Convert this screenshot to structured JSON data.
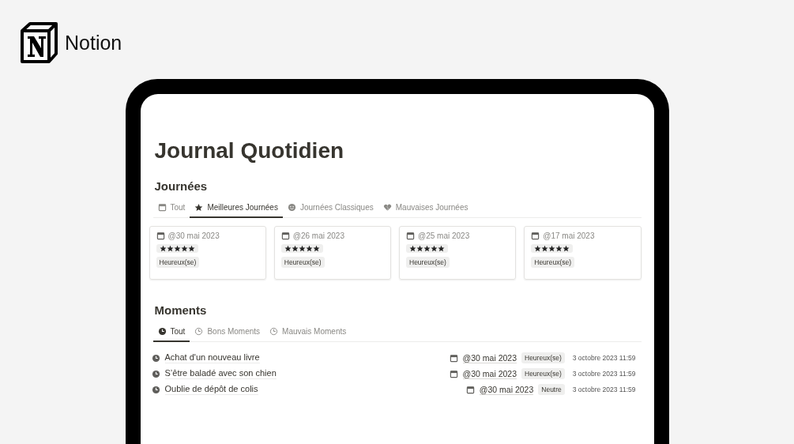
{
  "brand": {
    "name": "Notion"
  },
  "page": {
    "title": "Journal Quotidien"
  },
  "journees": {
    "heading": "Journées",
    "tabs": [
      {
        "label": "Tout",
        "selected": false
      },
      {
        "label": "Meilleures Journées",
        "selected": true
      },
      {
        "label": "Journées Classiques",
        "selected": false
      },
      {
        "label": "Mauvaises Journées",
        "selected": false
      }
    ],
    "cards": [
      {
        "date": "@30 mai 2023",
        "stars": 5,
        "tag": "Heureux(se)"
      },
      {
        "date": "@26 mai 2023",
        "stars": 5,
        "tag": "Heureux(se)"
      },
      {
        "date": "@25 mai 2023",
        "stars": 5,
        "tag": "Heureux(se)"
      },
      {
        "date": "@17 mai 2023",
        "stars": 5,
        "tag": "Heureux(se)"
      }
    ]
  },
  "moments": {
    "heading": "Moments",
    "tabs": [
      {
        "label": "Tout",
        "selected": true
      },
      {
        "label": "Bons Moments",
        "selected": false
      },
      {
        "label": "Mauvais Moments",
        "selected": false
      }
    ],
    "rows": [
      {
        "name": "Achat d'un nouveau livre",
        "date": "@30 mai 2023",
        "tag": "Heureux(se)",
        "created": "3 octobre 2023 11:59"
      },
      {
        "name": "S’être baladé avec son chien",
        "date": "@30 mai 2023",
        "tag": "Heureux(se)",
        "created": "3 octobre 2023 11:59"
      },
      {
        "name": "Oublie de dépôt de colis",
        "date": "@30 mai 2023",
        "tag": "Neutre",
        "created": "3 octobre 2023 11:59"
      }
    ]
  }
}
